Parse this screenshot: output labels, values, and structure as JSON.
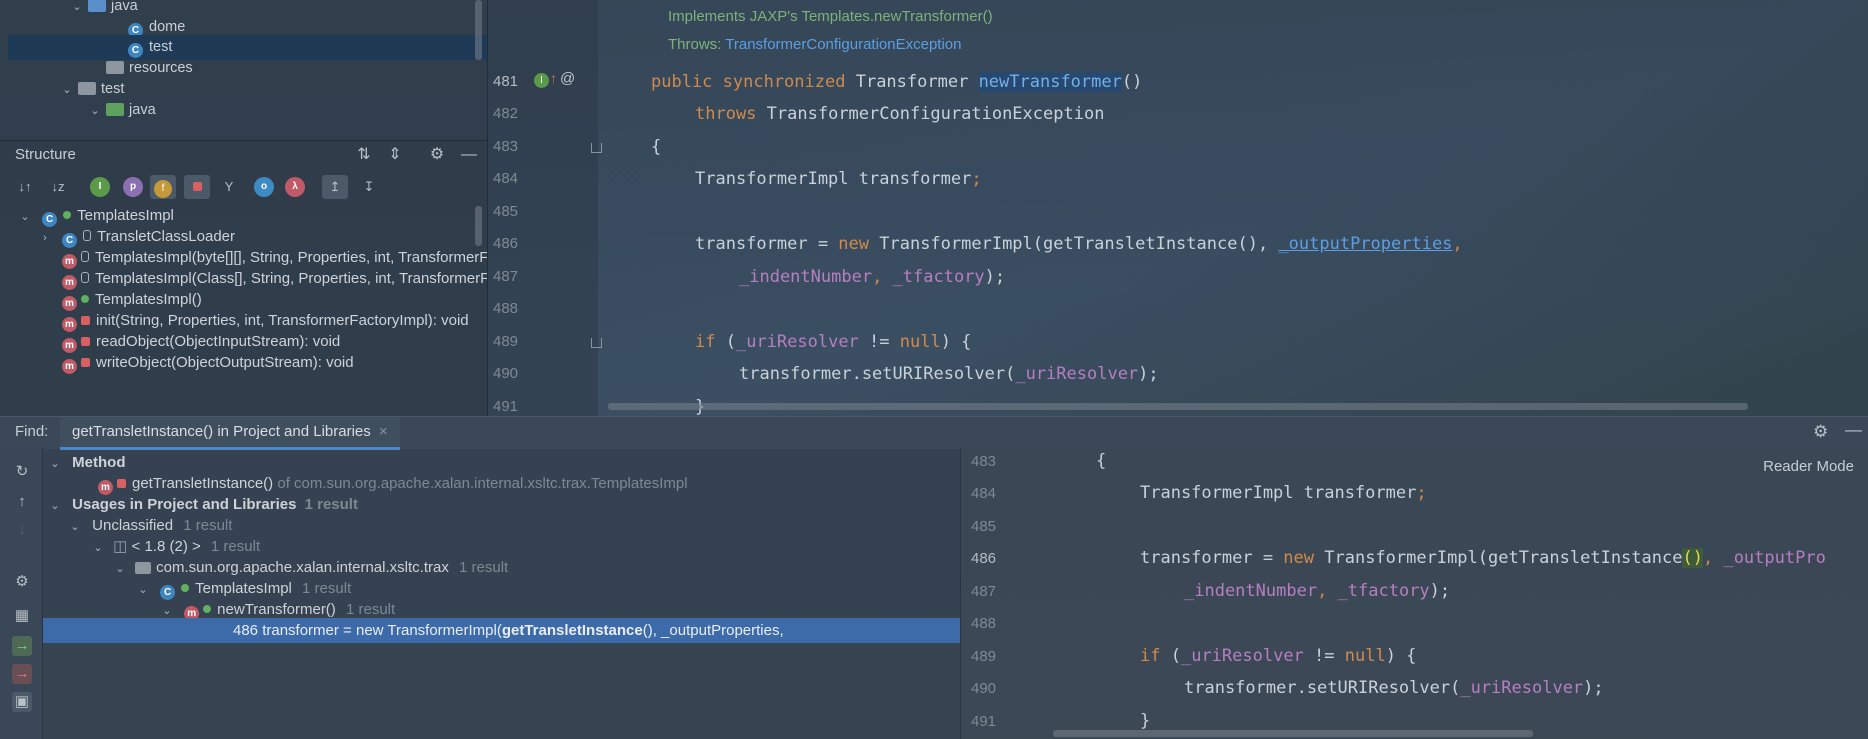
{
  "project_tree": {
    "items": [
      {
        "label": "java",
        "icon": "folder-icon"
      },
      {
        "label": "dome",
        "icon": "class-icon"
      },
      {
        "label": "test",
        "icon": "class-icon",
        "selected": true
      },
      {
        "label": "resources",
        "icon": "resources-folder-icon"
      },
      {
        "label": "test",
        "icon": "folder-icon"
      },
      {
        "label": "java",
        "icon": "folder-icon"
      }
    ]
  },
  "structure": {
    "title": "Structure",
    "items": [
      {
        "label": "TemplatesImpl"
      },
      {
        "label": "TransletClassLoader"
      },
      {
        "label": "TemplatesImpl(byte[][], String, Properties, int, TransformerFactoryImpl)"
      },
      {
        "label": "TemplatesImpl(Class[], String, Properties, int, TransformerFactoryImpl)"
      },
      {
        "label": "TemplatesImpl()"
      },
      {
        "label": "init(String, Properties, int, TransformerFactoryImpl): void"
      },
      {
        "label": "readObject(ObjectInputStream): void"
      },
      {
        "label": "writeObject(ObjectOutputStream): void"
      }
    ]
  },
  "editor": {
    "doc_line1": "Implements JAXP's Templates.newTransformer()",
    "doc_throws_label": "Throws:",
    "doc_throws_link": "TransformerConfigurationException",
    "lines": [
      "481",
      "482",
      "483",
      "484",
      "485",
      "486",
      "487",
      "488",
      "489",
      "490",
      "491"
    ],
    "code": {
      "l481_kw": "public synchronized",
      "l481_type": "Transformer",
      "l481_name": "newTransformer",
      "l481_tail": "()",
      "l482_kw": "throws",
      "l482_rest": "TransformerConfigurationException",
      "l483": "{",
      "l484": "TransformerImpl transformer",
      "semi": ";",
      "l486_a": "transformer = ",
      "l486_new": "new",
      "l486_b": " TransformerImpl(getTransletInstance(), ",
      "l486_fld": "_outputProperties",
      "comma": ",",
      "l487_fld1": "_indentNumber",
      "l487_sep": ", ",
      "l487_fld2": "_tfactory",
      "l487_end": ");",
      "l489_if": "if",
      "l489_a": " (",
      "l489_fld": "_uriResolver",
      "l489_b": " != ",
      "l489_null": "null",
      "l489_c": ") {",
      "l490_a": "transformer.setURIResolver(",
      "l490_fld": "_uriResolver",
      "l490_b": ");",
      "l491": "}"
    }
  },
  "find": {
    "label": "Find:",
    "tab": "getTransletInstance() in Project and Libraries",
    "tab_close": "×",
    "results": {
      "method_header": "Method",
      "method_name": "getTransletInstance()",
      "method_of": "of com.sun.org.apache.xalan.internal.xsltc.trax.TemplatesImpl",
      "usages_header": "Usages in Project and Libraries",
      "usages_count": "1 result",
      "unclassified": "Unclassified",
      "unclassified_count": "1 result",
      "jdk": "< 1.8 (2) >",
      "jdk_count": "1 result",
      "package": "com.sun.org.apache.xalan.internal.xsltc.trax",
      "package_count": "1 result",
      "class": "TemplatesImpl",
      "class_count": "1 result",
      "method": "newTransformer()",
      "method_count": "1 result",
      "usage_line_prefix": "486 transformer = new TransformerImpl(",
      "usage_line_bold": "getTransletInstance",
      "usage_line_suffix": "(), _outputProperties,"
    },
    "preview": {
      "reader_mode": "Reader Mode",
      "lines": [
        "483",
        "484",
        "485",
        "486",
        "487",
        "488",
        "489",
        "490",
        "491"
      ],
      "p486_b": " TransformerImpl(getTransletInstance",
      "p486_paren": "()",
      "p486_c": ", ",
      "p486_fld": "_outputPro"
    }
  }
}
